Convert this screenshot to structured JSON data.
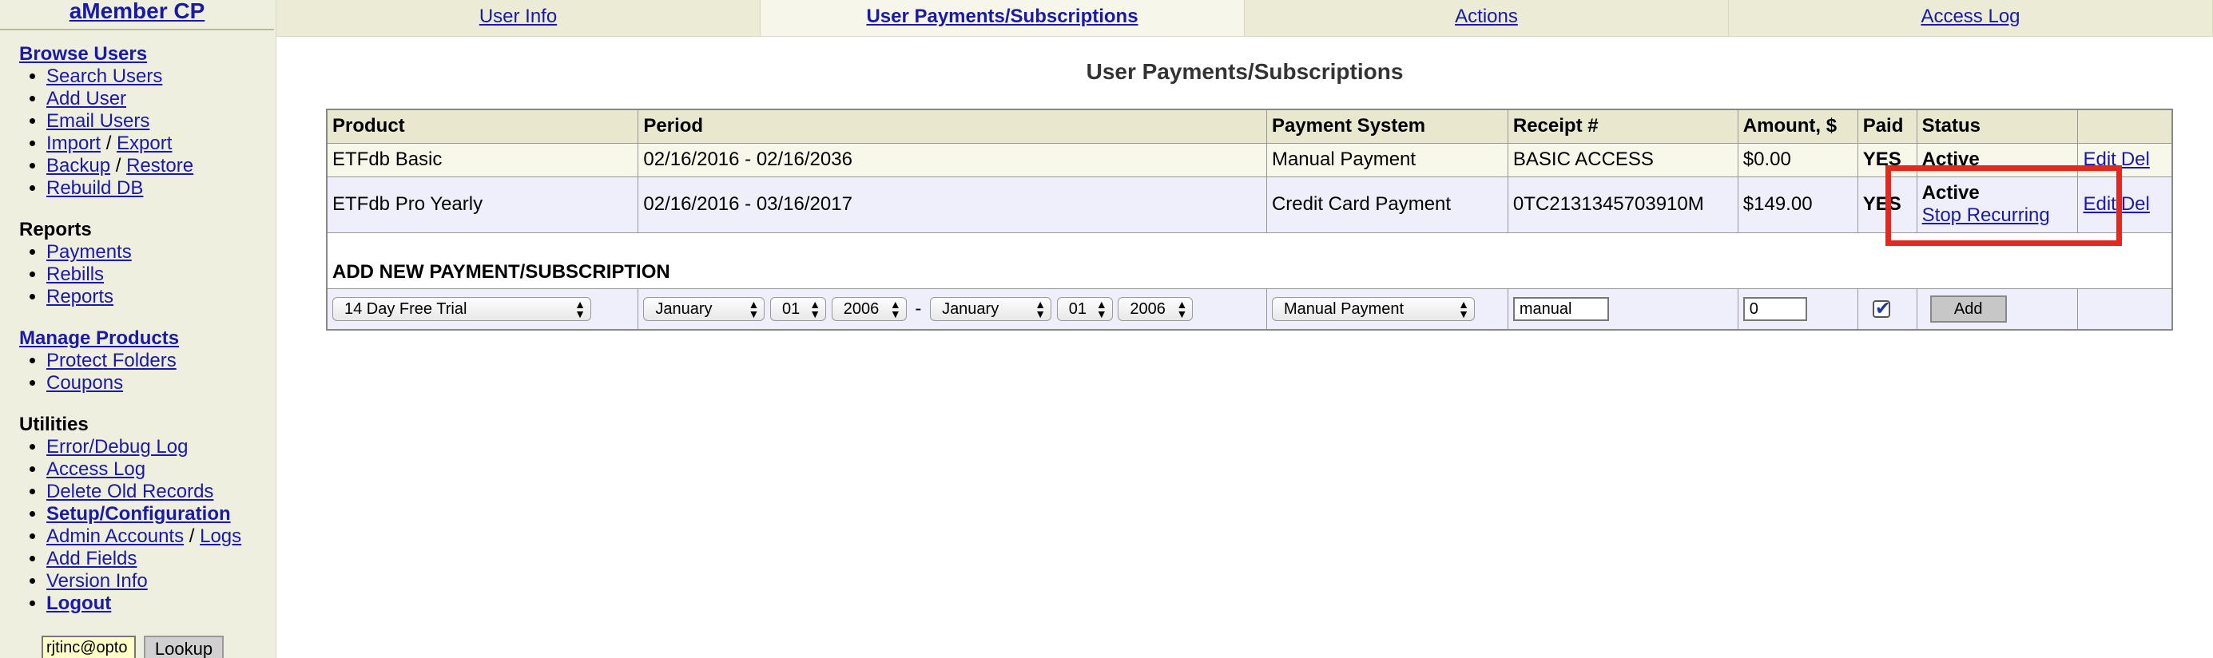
{
  "sidebar": {
    "brand": "aMember CP",
    "sections": {
      "browse": {
        "title": "Browse Users",
        "items": [
          "Search Users",
          "Add User",
          "Email Users"
        ],
        "import": "Import",
        "export": "Export",
        "backup": "Backup",
        "restore": "Restore",
        "rebuild": "Rebuild DB",
        "sep": "/"
      },
      "reports": {
        "title": "Reports",
        "items": [
          "Payments",
          "Rebills",
          "Reports"
        ]
      },
      "products": {
        "title": "Manage Products",
        "items": [
          "Protect Folders",
          "Coupons"
        ]
      },
      "utilities": {
        "title": "Utilities",
        "error_log": "Error/Debug Log",
        "access_log": "Access Log",
        "delete_old": "Delete Old Records",
        "setup": "Setup/Configuration",
        "admin_accounts": "Admin Accounts",
        "logs": "Logs",
        "add_fields": "Add Fields",
        "version": "Version Info",
        "logout": "Logout",
        "sep": "/"
      }
    },
    "lookup": {
      "value": "rjtinc@opto",
      "button": "Lookup"
    }
  },
  "tabs": [
    {
      "label": "User Info",
      "active": false
    },
    {
      "label": "User Payments/Subscriptions",
      "active": true
    },
    {
      "label": "Actions",
      "active": false
    },
    {
      "label": "Access Log",
      "active": false
    }
  ],
  "page_title": "User Payments/Subscriptions",
  "table": {
    "headers": [
      "Product",
      "Period",
      "Payment System",
      "Receipt #",
      "Amount, $",
      "Paid",
      "Status",
      ""
    ],
    "rows": [
      {
        "product": "ETFdb Basic",
        "period": "02/16/2016 - 02/16/2036",
        "system": "Manual Payment",
        "receipt": "BASIC ACCESS",
        "amount": "$0.00",
        "paid": "YES",
        "status": "Active",
        "edit": "Edit",
        "del": "Del"
      },
      {
        "product": "ETFdb Pro Yearly",
        "period": "02/16/2016 - 03/16/2017",
        "system": "Credit Card Payment",
        "receipt": "0TC2131345703910M",
        "amount": "$149.00",
        "paid": "YES",
        "status": "Active",
        "stop": "Stop Recurring",
        "edit": "Edit",
        "del": "Del"
      }
    ],
    "add_title": "ADD NEW PAYMENT/SUBSCRIPTION",
    "add_form": {
      "product": "14 Day Free Trial",
      "begin_month": "January",
      "begin_day": "01",
      "begin_year": "2006",
      "dash": "-",
      "end_month": "January",
      "end_day": "01",
      "end_year": "2006",
      "system": "Manual Payment",
      "receipt": "manual",
      "amount": "0",
      "paid_checked": true,
      "add_button": "Add"
    }
  },
  "colors": {
    "link": "#1a1aa6",
    "highlight": "#e02a1f",
    "sidebar_bg": "#efefdf"
  }
}
